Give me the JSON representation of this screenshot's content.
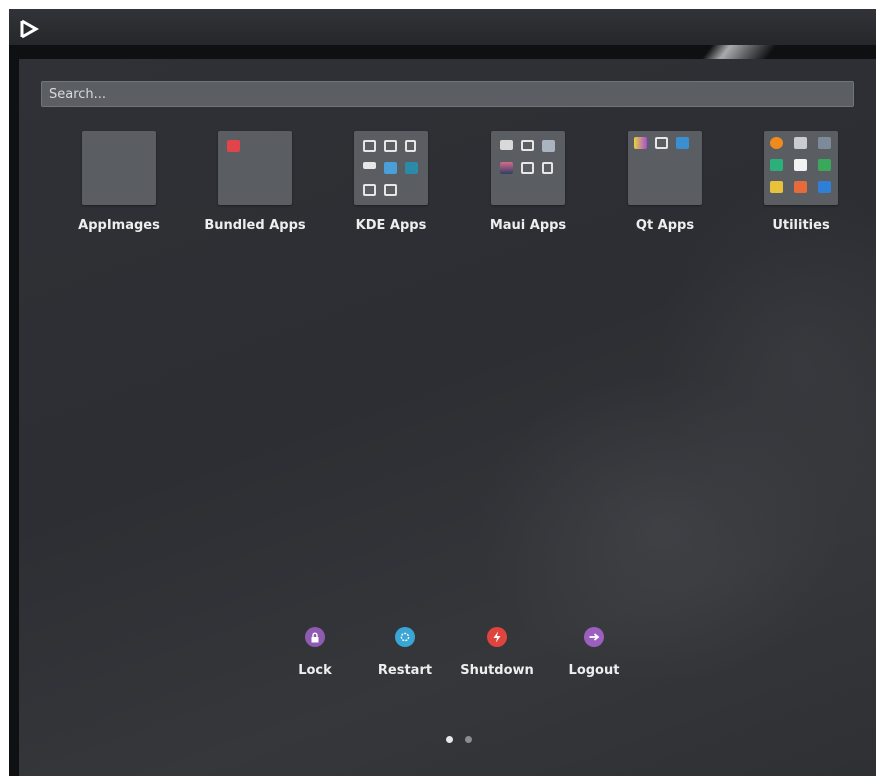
{
  "search": {
    "placeholder": "Search..."
  },
  "folders": [
    {
      "label": "AppImages"
    },
    {
      "label": "Bundled Apps"
    },
    {
      "label": "KDE Apps"
    },
    {
      "label": "Maui Apps"
    },
    {
      "label": "Qt Apps"
    },
    {
      "label": "Utilities"
    }
  ],
  "power": [
    {
      "label": "Lock",
      "icon": "lock-icon",
      "color": "#8e5bb0"
    },
    {
      "label": "Restart",
      "icon": "restart-icon",
      "color": "#3aa6d6"
    },
    {
      "label": "Shutdown",
      "icon": "shutdown-icon",
      "color": "#e0443f"
    },
    {
      "label": "Logout",
      "icon": "logout-icon",
      "color": "#9b5fc0"
    }
  ],
  "pager": {
    "pages": 2,
    "current": 1
  }
}
